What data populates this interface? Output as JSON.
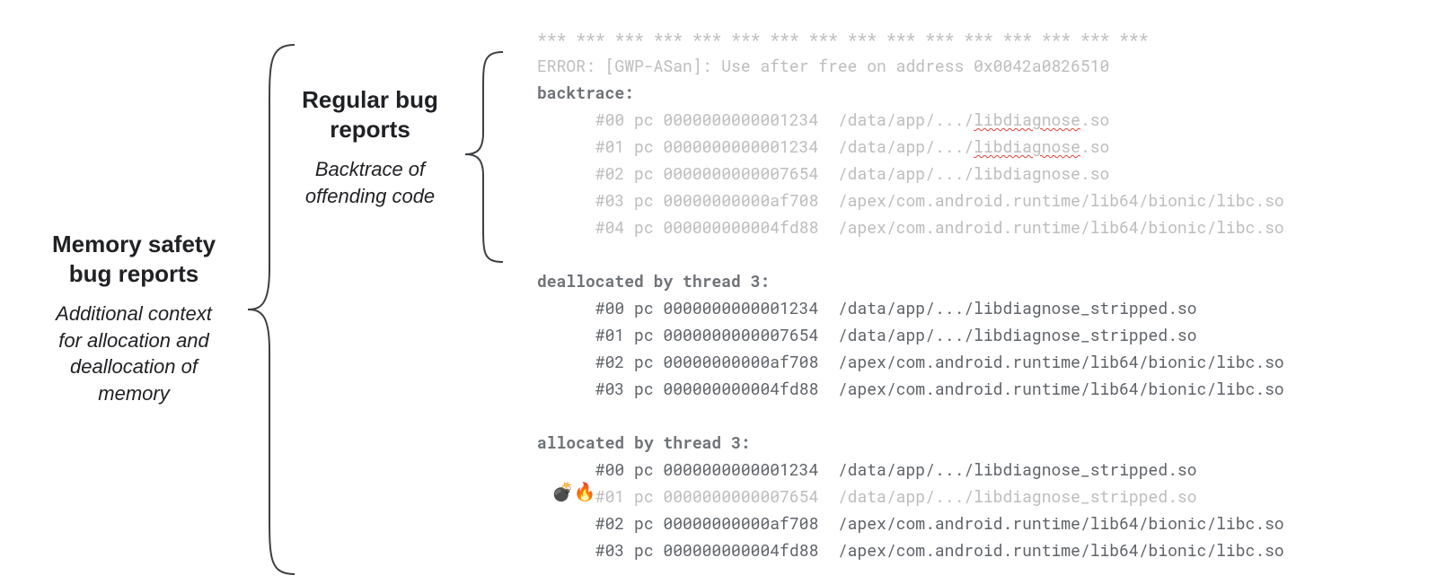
{
  "annotations": {
    "memory_safety": {
      "title_l1": "Memory safety",
      "title_l2": "bug reports",
      "sub_l1": "Additional context",
      "sub_l2": "for allocation and",
      "sub_l3": "deallocation of",
      "sub_l4": "memory"
    },
    "regular": {
      "title_l1": "Regular bug",
      "title_l2": "reports",
      "sub_l1": "Backtrace of",
      "sub_l2": "offending code"
    }
  },
  "report": {
    "separator": "*** *** *** *** *** *** *** *** *** *** *** *** *** *** *** ***",
    "error_line": "ERROR: [GWP-ASan]: Use after free on address 0x0042a0826510",
    "backtrace_heading": "backtrace:",
    "backtrace": [
      {
        "frame": "#00",
        "pc": "0000000000001234",
        "path_prefix": "/data/app/.../",
        "lib": "libdiagnose",
        "ext": ".so",
        "misspelled": true
      },
      {
        "frame": "#01",
        "pc": "0000000000001234",
        "path_prefix": "/data/app/.../",
        "lib": "libdiagnose",
        "ext": ".so",
        "misspelled": true
      },
      {
        "frame": "#02",
        "pc": "0000000000007654",
        "path_prefix": "/data/app/.../",
        "lib": "libdiagnose",
        "ext": ".so",
        "misspelled": false
      },
      {
        "frame": "#03",
        "pc": "00000000000af708",
        "path_prefix": "/apex/com.android.runtime/lib64/bionic/",
        "lib": "libc",
        "ext": ".so",
        "misspelled": false
      },
      {
        "frame": "#04",
        "pc": "000000000004fd88",
        "path_prefix": "/apex/com.android.runtime/lib64/bionic/",
        "lib": "libc",
        "ext": ".so",
        "misspelled": false
      }
    ],
    "dealloc_heading": "deallocated by thread 3:",
    "dealloc": [
      {
        "frame": "#00",
        "pc": "0000000000001234",
        "path": "/data/app/.../libdiagnose_stripped.so"
      },
      {
        "frame": "#01",
        "pc": "0000000000007654",
        "path": "/data/app/.../libdiagnose_stripped.so"
      },
      {
        "frame": "#02",
        "pc": "00000000000af708",
        "path": "/apex/com.android.runtime/lib64/bionic/libc.so"
      },
      {
        "frame": "#03",
        "pc": "000000000004fd88",
        "path": "/apex/com.android.runtime/lib64/bionic/libc.so"
      }
    ],
    "alloc_heading": "allocated by thread 3:",
    "alloc": [
      {
        "frame": "#00",
        "pc": "0000000000001234",
        "path": "/data/app/.../libdiagnose_stripped.so",
        "marked": false
      },
      {
        "frame": "#01",
        "pc": "0000000000007654",
        "path": "/data/app/.../libdiagnose_stripped.so",
        "marked": true
      },
      {
        "frame": "#02",
        "pc": "00000000000af708",
        "path": "/apex/com.android.runtime/lib64/bionic/libc.so",
        "marked": false
      },
      {
        "frame": "#03",
        "pc": "000000000004fd88",
        "path": "/apex/com.android.runtime/lib64/bionic/libc.so",
        "marked": false
      }
    ],
    "markers": "💣🔥"
  }
}
